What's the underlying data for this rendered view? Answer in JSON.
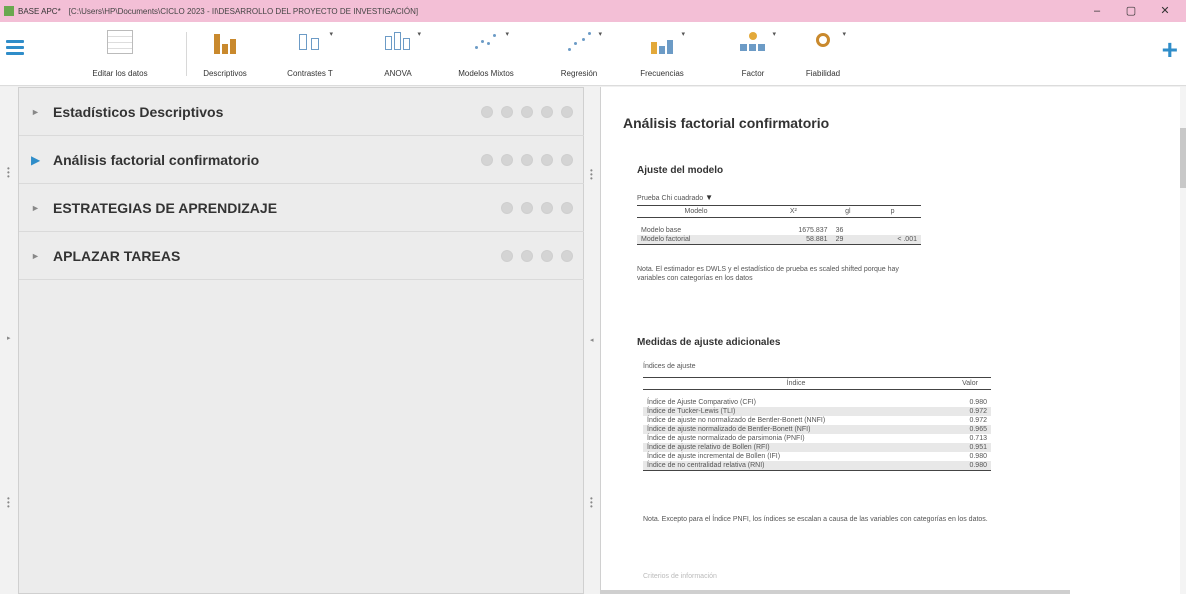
{
  "window": {
    "app_name": "BASE APC*",
    "path": "[C:\\Users\\HP\\Documents\\CICLO 2023 - II\\DESARROLLO DEL PROYECTO DE INVESTIGACIÓN]",
    "controls": {
      "minimize": "–",
      "maximize": "▢",
      "close": "✕"
    }
  },
  "toolbar": {
    "tools": [
      {
        "label": "Editar los datos",
        "icon": "table-icon"
      },
      {
        "label": "Descriptivos",
        "icon": "bar-chart-icon"
      },
      {
        "label": "Contrastes T",
        "icon": "t-test-icon"
      },
      {
        "label": "ANOVA",
        "icon": "anova-icon"
      },
      {
        "label": "Modelos Mixtos",
        "icon": "mixed-models-icon"
      },
      {
        "label": "Regresión",
        "icon": "regression-icon"
      },
      {
        "label": "Frecuencias",
        "icon": "frequencies-icon"
      },
      {
        "label": "Factor",
        "icon": "factor-icon"
      },
      {
        "label": "Fiabilidad",
        "icon": "reliability-icon"
      }
    ],
    "plus": "+"
  },
  "analyses": [
    {
      "title": "Estadísticos Descriptivos",
      "active": false,
      "circles": 5
    },
    {
      "title": "Análisis factorial confirmatorio",
      "active": true,
      "circles": 5
    },
    {
      "title": "ESTRATEGIAS DE APRENDIZAJE",
      "active": false,
      "circles": 4
    },
    {
      "title": "APLAZAR TAREAS",
      "active": false,
      "circles": 4
    }
  ],
  "results": {
    "heading": "Análisis factorial confirmatorio",
    "fit": {
      "heading": "Ajuste del modelo",
      "table_title": "Prueba Chi cuadrado",
      "columns": [
        "Modelo",
        "X²",
        "gl",
        "p"
      ],
      "rows": [
        [
          "Modelo base",
          "1675.837",
          "36",
          ""
        ],
        [
          "Modelo factorial",
          "58.881",
          "29",
          "< .001"
        ]
      ],
      "note": "Nota. El estimador es DWLS y el estadístico de prueba es scaled shifted porque hay variables con categorías en los datos"
    },
    "additional": {
      "heading": "Medidas de ajuste adicionales",
      "table_title": "Índices de ajuste",
      "columns": [
        "Índice",
        "Valor"
      ],
      "rows": [
        [
          "Índice de Ajuste Comparativo (CFI)",
          "0.980"
        ],
        [
          "Índice de Tucker-Lewis (TLI)",
          "0.972"
        ],
        [
          "Índice de ajuste no normalizado de Bentler-Bonett (NNFI)",
          "0.972"
        ],
        [
          "Índice de ajuste normalizado de Bentler-Bonett (NFI)",
          "0.965"
        ],
        [
          "Índice de ajuste normalizado de parsimonia (PNFI)",
          "0.713"
        ],
        [
          "Índice de ajuste relativo de Bollen (RFI)",
          "0.951"
        ],
        [
          "Índice de ajuste incremental de Bollen (IFI)",
          "0.980"
        ],
        [
          "Índice de no centralidad relativa (RNI)",
          "0.980"
        ]
      ],
      "note": "Nota. Excepto para el Índice PNFI, los índices se escalan a causa de las variables con categorías en los datos."
    },
    "more": "Criterios de información"
  }
}
